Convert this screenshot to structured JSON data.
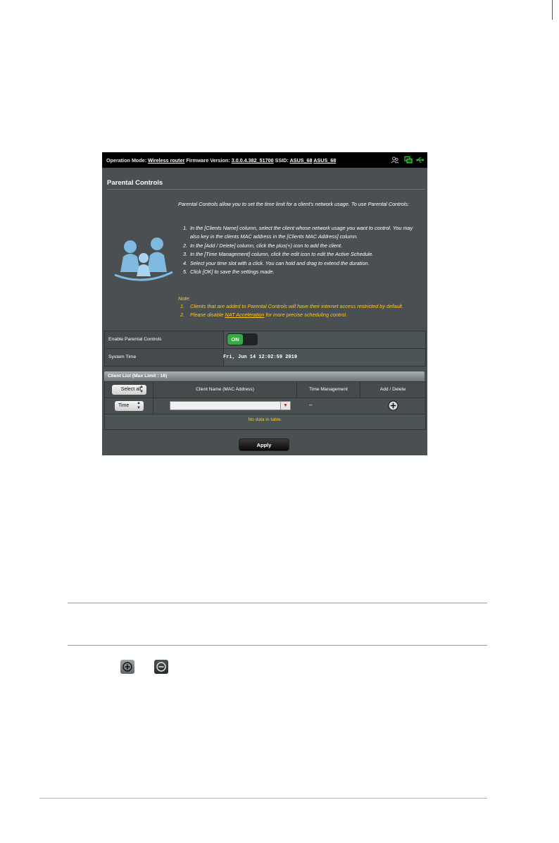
{
  "topbar": {
    "operation_mode_label": "Operation Mode:",
    "operation_mode_value": "Wireless router",
    "firmware_label": "Firmware Version:",
    "firmware_value": "3.0.0.4.382_51700",
    "ssid_label": "SSID:",
    "ssid_1": "ASUS_68",
    "ssid_2": "ASUS_68"
  },
  "page": {
    "title": "Parental Controls",
    "intro": "Parental Controls allow you to set the time limit for a client's network usage. To use Parental Controls:",
    "steps": [
      {
        "num": "1.",
        "text": "In the [Clients Name] column, select the client whose network usage you want to control. You may also key in the clients MAC address in the [Clients MAC Address] column."
      },
      {
        "num": "2.",
        "text": "In the [Add / Delete] column, click the plus(+) icon to add the client."
      },
      {
        "num": "3.",
        "text": "In the [Time Management] column, click the edit icon to edit the Active Schedule."
      },
      {
        "num": "4.",
        "text": "Select your time slot with a click. You can hold and drag to extend the duration."
      },
      {
        "num": "5.",
        "text": "Click [OK] to save the settings made."
      }
    ],
    "note_title": "Note:",
    "note_1_num": "1.",
    "note_1": "Clients that are added to Parental Controls will have their internet access restricted by default.",
    "note_2_num": "2.",
    "note_2_pre": "Please disable ",
    "note_2_link": "NAT Acceleration",
    "note_2_post": " for more precise scheduling control."
  },
  "settings": {
    "enable_label": "Enable Parental Controls",
    "toggle_state": "ON",
    "system_time_label": "System Time",
    "system_time_value": "Fri, Jun 14 12:02:59 2019"
  },
  "client_list": {
    "title": "Client List (Max Limit : 16)",
    "select_all": "Select all",
    "col_client_name": "Client Name (MAC Address)",
    "col_time_management": "Time Management",
    "col_add_delete": "Add / Delete",
    "row_select": "Time",
    "row_time_value": "–",
    "no_data": "No data in table."
  },
  "apply_label": "Apply",
  "colors": {
    "panel_bg": "#4a5052",
    "topbar_bg": "#000000",
    "note_color": "#ffc726",
    "toggle_on": "#3aa843"
  },
  "icons": [
    "clients-icon",
    "router-icon",
    "usb-icon",
    "family-icon",
    "add-icon",
    "delete-icon"
  ]
}
